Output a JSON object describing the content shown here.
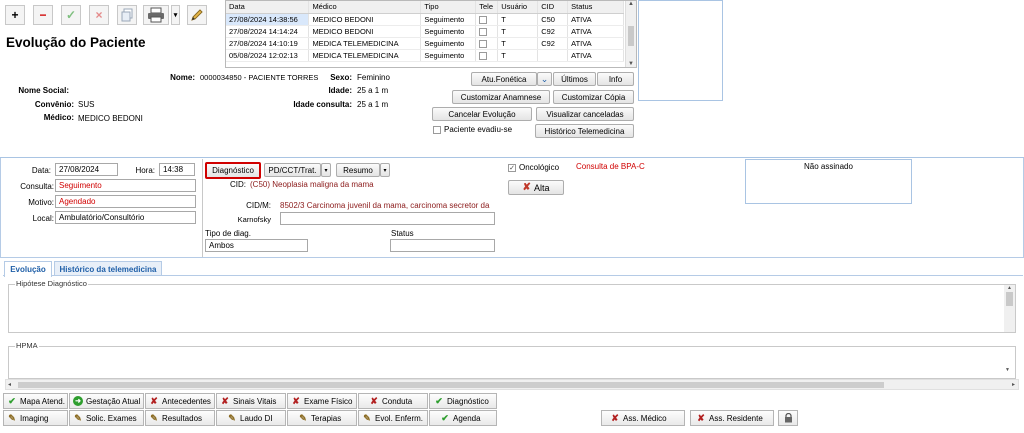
{
  "toolbar": {
    "add": "+",
    "remove": "−",
    "confirm": "✓",
    "cancel": "×"
  },
  "title": "Evolução do Paciente",
  "patient": {
    "nome_label": "Nome:",
    "nome_value": "0000034850 - PACIENTE TORRES",
    "nome_social_label": "Nome Social:",
    "nome_social_value": "",
    "convenio_label": "Convênio:",
    "convenio_value": "SUS",
    "medico_label": "Médico:",
    "medico_value": "MEDICO BEDONI",
    "sexo_label": "Sexo:",
    "sexo_value": "Feminino",
    "idade_label": "Idade:",
    "idade_value": "25 a 1 m",
    "idade_consulta_label": "Idade consulta:",
    "idade_consulta_value": "25 a 1 m"
  },
  "grid": {
    "headers": [
      "Data",
      "Médico",
      "Tipo",
      "Tele",
      "Usuário",
      "CID",
      "Status"
    ],
    "rows": [
      [
        "27/08/2024 14:38:56",
        "MEDICO BEDONI",
        "Seguimento",
        "",
        "T",
        "C50",
        "ATIVA"
      ],
      [
        "27/08/2024 14:14:24",
        "MEDICO BEDONI",
        "Seguimento",
        "",
        "T",
        "C92",
        "ATIVA"
      ],
      [
        "27/08/2024 14:10:19",
        "MEDICA TELEMEDICINA",
        "Seguimento",
        "",
        "T",
        "C92",
        "ATIVA"
      ],
      [
        "05/08/2024 12:02:13",
        "MEDICA TELEMEDICINA",
        "Seguimento",
        "",
        "T",
        "",
        "ATIVA"
      ]
    ]
  },
  "actions": {
    "atu_fonetica": "Atu.Fonética",
    "ultimos": "Últimos",
    "info": "Info",
    "customizar_anamnese": "Customizar Anamnese",
    "customizar_copia": "Customizar Cópia",
    "cancelar_evolucao": "Cancelar Evolução",
    "visualizar_canceladas": "Visualizar canceladas",
    "paciente_evadiu": "Paciente evadiu-se",
    "historico_telemedicina": "Histórico Telemedicina"
  },
  "form": {
    "data_label": "Data:",
    "data_value": "27/08/2024",
    "hora_label": "Hora:",
    "hora_value": "14:38",
    "consulta_label": "Consulta:",
    "consulta_value": "Seguimento",
    "motivo_label": "Motivo:",
    "motivo_value": "Agendado",
    "local_label": "Local:",
    "local_value": "Ambulatório/Consultório",
    "tab_diagnostico": "Diagnóstico",
    "tab_pdcct": "PD/CCT/Trat.",
    "tab_resumo": "Resumo",
    "cid_label": "CID:",
    "cid_value": "(C50) Neoplasia maligna da mama",
    "cidm_label": "CID/M:",
    "cidm_value": "8502/3 Carcinoma juvenil da mama, carcinoma secretor da",
    "karnofsky_label": "Karnofsky",
    "tipo_diag_label": "Tipo de diag.",
    "tipo_diag_value": "Ambos",
    "status_label": "Status",
    "status_value": "",
    "oncologico_label": "Oncológico",
    "consulta_bpa": "Consulta de BPA-C",
    "alta_label": "Alta",
    "nao_assinado": "Não assinado"
  },
  "tabs": {
    "evolucao": "Evolução",
    "historico": "Histórico da telemedicina"
  },
  "sections": {
    "hipotese": "Hipótese Diagnóstico",
    "hpma": "HPMA"
  },
  "bottom": {
    "row1": [
      "Mapa Atend.",
      "Gestação Atual",
      "Antecedentes",
      "Sinais Vitais",
      "Exame Físico",
      "Conduta",
      "Diagnóstico"
    ],
    "row2": [
      "Imaging",
      "Solic. Exames",
      "Resultados",
      "Laudo DI",
      "Terapias",
      "Evol. Enferm.",
      "Agenda"
    ],
    "ass_medico": "Ass. Médico",
    "ass_residente": "Ass. Residente"
  },
  "colors": {
    "accent": "#1f5fa8",
    "red": "#d00000",
    "green": "#2e9e2e",
    "highlight": "#d9e8fb"
  }
}
